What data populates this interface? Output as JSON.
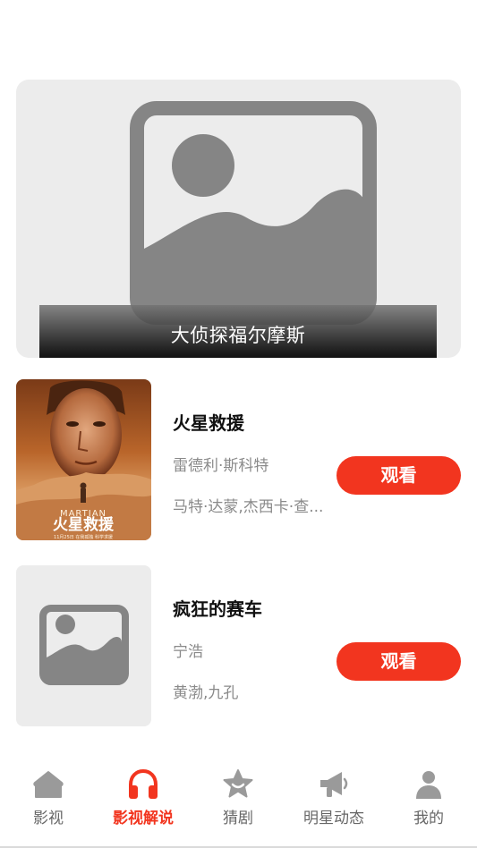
{
  "banner": {
    "title": "大侦探福尔摩斯",
    "image_icon": "image-placeholder-icon"
  },
  "movies": [
    {
      "title": "火星救援",
      "director": "雷德利·斯科特",
      "cast": "马特·达蒙,杰西卡·查...",
      "button_label": "观看",
      "poster": "the-martian-poster",
      "poster_text": {
        "name_en": "MARTIAN",
        "name_cn": "火星救援",
        "tagline": "11月25日 在我孤独 科学求援"
      }
    },
    {
      "title": "疯狂的赛车",
      "director": "宁浩",
      "cast": "黄渤,九孔",
      "button_label": "观看",
      "poster": "image-placeholder-icon"
    }
  ],
  "tabbar": {
    "active_color": "#f2351f",
    "items": [
      {
        "label": "影视",
        "icon": "home-icon",
        "active": false
      },
      {
        "label": "影视解说",
        "icon": "headphones-icon",
        "active": true
      },
      {
        "label": "猜剧",
        "icon": "star-badge-icon",
        "active": false
      },
      {
        "label": "明星动态",
        "icon": "megaphone-icon",
        "active": false
      },
      {
        "label": "我的",
        "icon": "user-icon",
        "active": false
      }
    ]
  }
}
